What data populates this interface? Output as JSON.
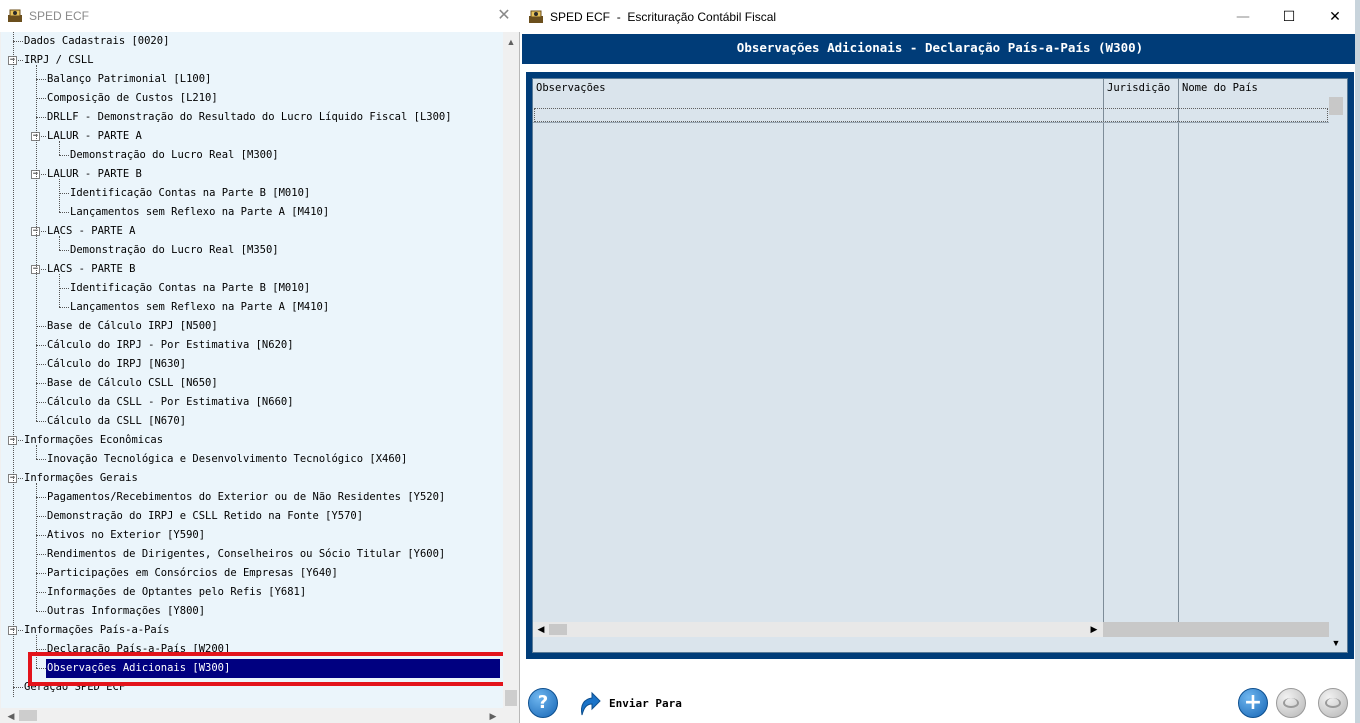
{
  "left_window": {
    "title": "SPED ECF",
    "close_glyph": "✕"
  },
  "tree": {
    "rows": [
      {
        "text": "Dados Cadastrais [0020]"
      },
      {
        "text": "IRPJ / CSLL"
      },
      {
        "text": "Balanço Patrimonial [L100]"
      },
      {
        "text": "Composição de Custos [L210]"
      },
      {
        "text": "DRLLF - Demonstração do Resultado do Lucro Líquido Fiscal [L300]"
      },
      {
        "text": "LALUR - PARTE A"
      },
      {
        "text": "Demonstração do Lucro Real [M300]"
      },
      {
        "text": "LALUR - PARTE B"
      },
      {
        "text": "Identificação Contas na Parte B [M010]"
      },
      {
        "text": "Lançamentos sem Reflexo na Parte A [M410]"
      },
      {
        "text": "LACS - PARTE A"
      },
      {
        "text": "Demonstração do Lucro Real [M350]"
      },
      {
        "text": "LACS - PARTE B"
      },
      {
        "text": "Identificação Contas na Parte B [M010]"
      },
      {
        "text": "Lançamentos sem Reflexo na Parte A [M410]"
      },
      {
        "text": "Base de Cálculo IRPJ [N500]"
      },
      {
        "text": "Cálculo do IRPJ - Por Estimativa [N620]"
      },
      {
        "text": "Cálculo do IRPJ [N630]"
      },
      {
        "text": "Base de Cálculo CSLL [N650]"
      },
      {
        "text": "Cálculo da CSLL - Por Estimativa [N660]"
      },
      {
        "text": "Cálculo da CSLL [N670]"
      },
      {
        "text": "Informações Econômicas"
      },
      {
        "text": "Inovação Tecnológica e Desenvolvimento Tecnológico [X460]"
      },
      {
        "text": "Informações Gerais"
      },
      {
        "text": "Pagamentos/Recebimentos do Exterior ou de Não Residentes [Y520]"
      },
      {
        "text": "Demonstração do IRPJ e CSLL Retido na Fonte [Y570]"
      },
      {
        "text": "Ativos no Exterior [Y590]"
      },
      {
        "text": "Rendimentos de Dirigentes, Conselheiros ou Sócio Titular [Y600]"
      },
      {
        "text": "Participações em Consórcios de Empresas [Y640]"
      },
      {
        "text": "Informações de Optantes pelo Refis [Y681]"
      },
      {
        "text": "Outras Informações [Y800]"
      },
      {
        "text": "Informações País-a-País"
      },
      {
        "text": "Declaração País-a-País [W200]"
      },
      {
        "text": "Observações Adicionais [W300]"
      },
      {
        "text": "Geração SPED ECF"
      }
    ],
    "selected_index": 33
  },
  "right_window": {
    "title_app": "SPED ECF",
    "title_sep": "-",
    "title_doc": "Escrituração Contábil Fiscal",
    "minimize_glyph": "—",
    "maximize_glyph": "☐",
    "close_glyph": "✕"
  },
  "panel": {
    "header": "Observações Adicionais - Declaração País-a-País (W300)",
    "columns": [
      "Observações",
      "Jurisdição",
      "Nome do País"
    ]
  },
  "toolbar": {
    "help_label": "?",
    "send_label": "Enviar Para",
    "add_label": "+"
  },
  "colors": {
    "header_band": "#003c78",
    "selection": "#000080",
    "highlight_box": "#e3141b",
    "tree_bg": "#ebf5fb",
    "grid_bg": "#dae4ec"
  }
}
